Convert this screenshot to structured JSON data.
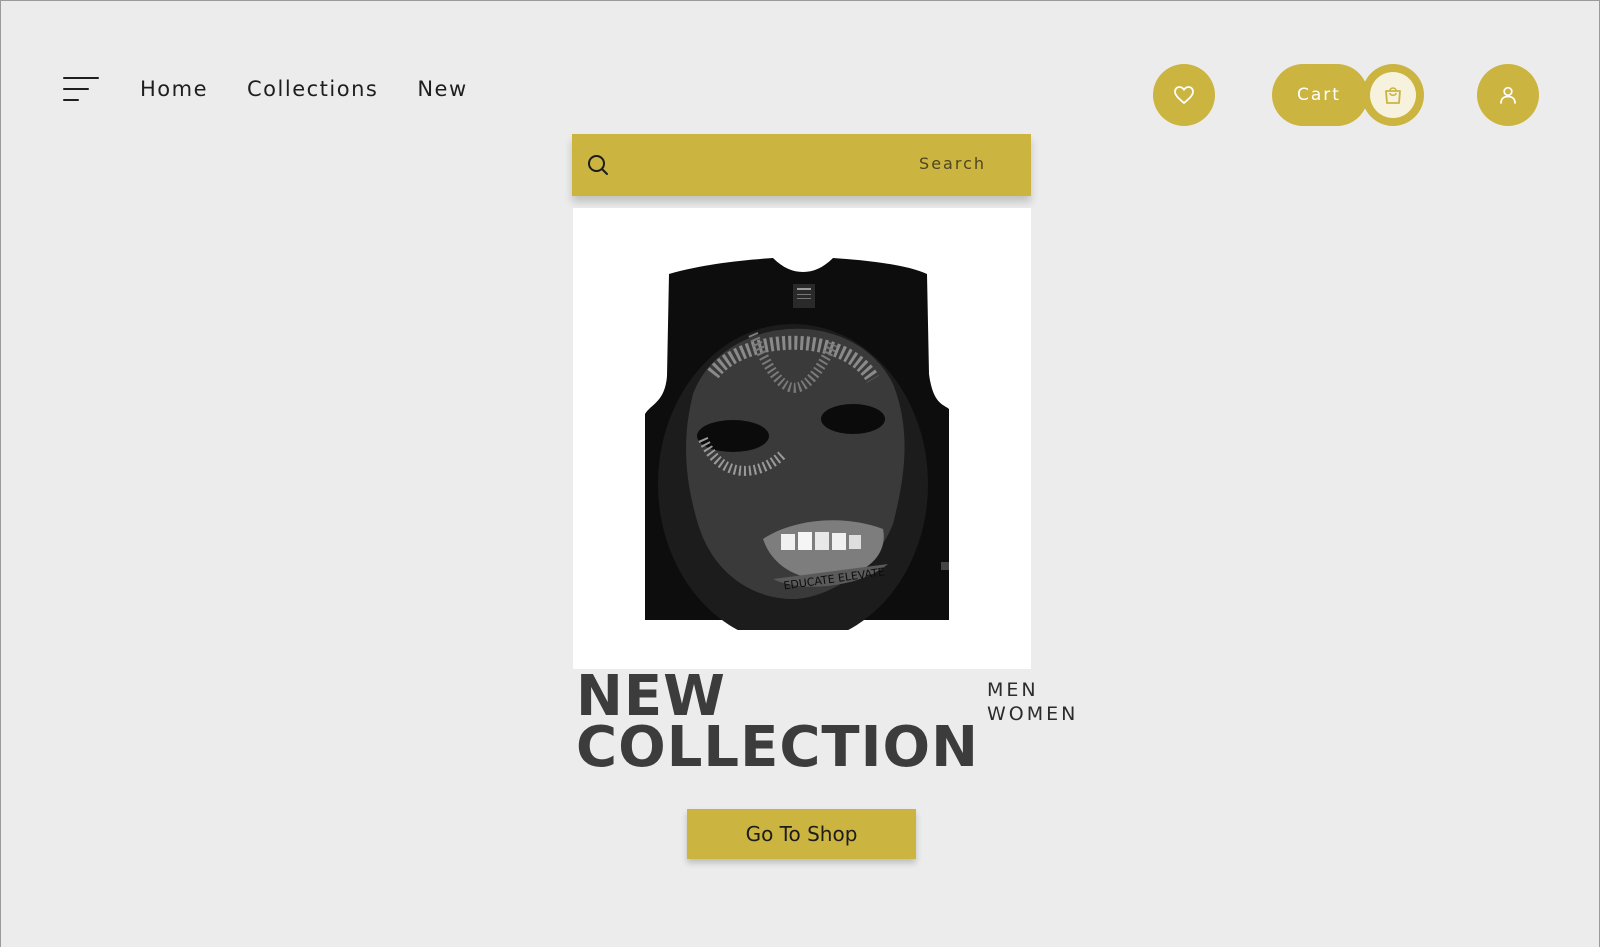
{
  "nav": {
    "menu_icon": "hamburger-menu-icon",
    "links": [
      {
        "label": "Home"
      },
      {
        "label": "Collections"
      },
      {
        "label": "New"
      }
    ]
  },
  "actions": {
    "favorite_icon": "heart-outline-icon",
    "cart_label": "Cart",
    "cart_icon": "shopping-bag-icon",
    "account_icon": "user-icon"
  },
  "search": {
    "placeholder": "Search",
    "icon": "search-icon"
  },
  "hero": {
    "image_alt": "Black sleeveless shirt with balaclava face graphic",
    "graphic_text": "EDUCATE ELEVATE",
    "headline_line1": "NEW",
    "headline_line2": "COLLECTION",
    "categories": [
      "MEN",
      "WOMEN"
    ],
    "cta_label": "Go To Shop"
  },
  "colors": {
    "accent": "#cbb43f",
    "background": "#ececec",
    "text": "#2b2b2b",
    "headline": "#3c3c3c"
  }
}
